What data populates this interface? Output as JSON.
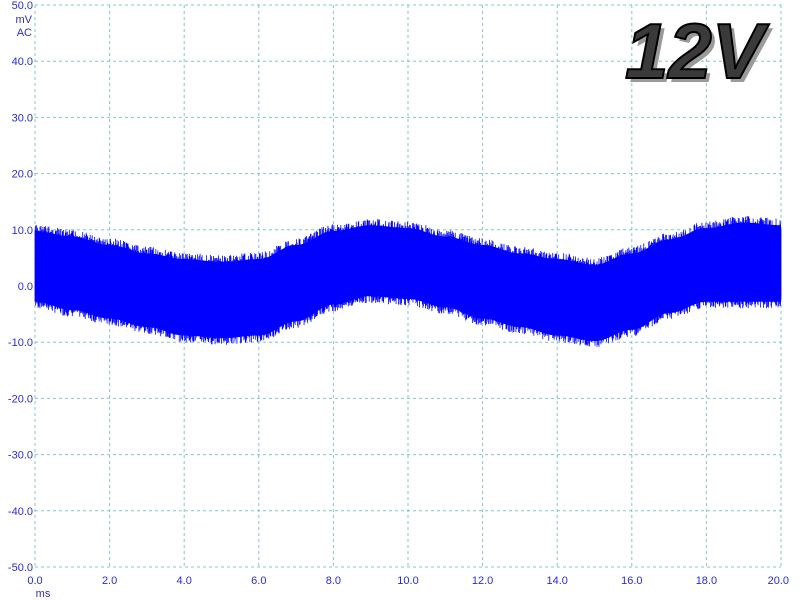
{
  "badge_text": "12V",
  "y_unit": "mV",
  "coupling": "AC",
  "x_unit": "ms",
  "colors": {
    "trace": "#0000ff",
    "grid": "#7fc8c8",
    "tick_text": "#2b2bd6"
  },
  "chart_data": {
    "type": "line",
    "title": "",
    "xlabel": "ms",
    "ylabel": "mV",
    "xlim": [
      0,
      20
    ],
    "ylim": [
      -50,
      50
    ],
    "grid": true,
    "x_ticks": [
      "0.0",
      "2.0",
      "4.0",
      "6.0",
      "8.0",
      "10.0",
      "12.0",
      "14.0",
      "16.0",
      "18.0",
      "20.0"
    ],
    "y_ticks": [
      "50.0",
      "40.0",
      "30.0",
      "20.0",
      "10.0",
      "0.0",
      "-10.0",
      "-20.0",
      "-30.0",
      "-40.0",
      "-50.0"
    ],
    "series": [
      {
        "x": [
          0.0,
          1.0,
          2.0,
          3.0,
          4.0,
          5.0,
          6.0,
          7.0,
          8.0,
          9.0,
          10.0,
          11.0,
          12.0,
          13.0,
          14.0,
          15.0,
          16.0,
          17.0,
          18.0,
          19.0,
          20.0
        ],
        "upper": [
          11.0,
          10.0,
          8.5,
          7.0,
          6.0,
          5.5,
          6.0,
          8.5,
          11.0,
          12.0,
          11.5,
          10.0,
          8.5,
          7.0,
          6.0,
          5.0,
          7.0,
          9.5,
          11.5,
          12.5,
          12.0
        ],
        "lower": [
          -4.0,
          -5.5,
          -7.0,
          -8.5,
          -10.0,
          -10.5,
          -10.0,
          -7.5,
          -4.5,
          -3.0,
          -3.5,
          -5.0,
          -7.0,
          -8.5,
          -10.0,
          -11.0,
          -9.0,
          -6.0,
          -4.0,
          -4.0,
          -4.0
        ]
      }
    ]
  }
}
